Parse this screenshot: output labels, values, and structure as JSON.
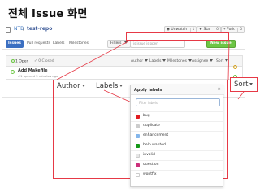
{
  "slide": {
    "title": "전체 Issue 화면"
  },
  "repo": {
    "owner": "NTB",
    "separator": "/",
    "name": "test-repo"
  },
  "header_buttons": {
    "unwatch": "Unwatch",
    "unwatch_count": "1",
    "star": "Star",
    "star_count": "0",
    "fork": "Fork",
    "fork_count": "0"
  },
  "tabs": [
    {
      "label": "Issues"
    },
    {
      "label": "Pull requests"
    },
    {
      "label": "Labels"
    },
    {
      "label": "Milestones"
    }
  ],
  "toolbar": {
    "filters_label": "Filters",
    "search_placeholder": "is:issue is:open",
    "new_issue_label": "New issue"
  },
  "list_header": {
    "open_count": "1 Open",
    "closed_count": "0 Closed",
    "filters": [
      "Author",
      "Labels",
      "Milestones",
      "Assignee",
      "Sort"
    ]
  },
  "issue": {
    "title": "Add Makefile",
    "meta": "#1 opened 5 minutes ago"
  },
  "zoom": {
    "author_label": "Author",
    "labels_label": "Labels",
    "sort_label": "Sort"
  },
  "dropdown": {
    "title": "Apply labels",
    "close_glyph": "×",
    "filter_placeholder": "Filter labels",
    "items": [
      {
        "label": "bug",
        "color": "#e11d21"
      },
      {
        "label": "duplicate",
        "color": "#cccccc"
      },
      {
        "label": "enhancement",
        "color": "#84b6eb"
      },
      {
        "label": "help wanted",
        "color": "#159818"
      },
      {
        "label": "invalid",
        "color": "#e6e6e6"
      },
      {
        "label": "question",
        "color": "#cc317c"
      },
      {
        "label": "wontfix",
        "color": "#ffffff"
      }
    ]
  },
  "colors": {
    "accent_red": "#e63946",
    "primary_blue": "#3b6fc1",
    "new_issue_green": "#6cc644"
  }
}
